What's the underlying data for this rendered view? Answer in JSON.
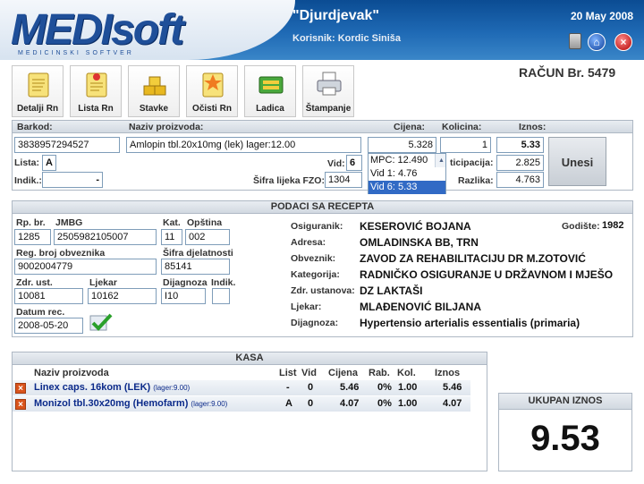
{
  "header": {
    "logo": "MEDIsoft",
    "logo_subtitle": "MEDICINSKI SOFTVER",
    "pharmacy": "\"Djurdjevak\"",
    "user": "Korisnik: Kordic Siniša",
    "date": "20 May 2008"
  },
  "toolbar": [
    {
      "label": "Detalji Rn",
      "icon": "notepad-icon"
    },
    {
      "label": "Lista Rn",
      "icon": "notepad-pin-icon"
    },
    {
      "label": "Stavke",
      "icon": "coins-icon"
    },
    {
      "label": "Očisti Rn",
      "icon": "notepad-star-icon"
    },
    {
      "label": "Ladica",
      "icon": "cash-drawer-icon"
    },
    {
      "label": "Štampanje",
      "icon": "printer-icon"
    }
  ],
  "racun": "RAČUN Br. 5479",
  "entry": {
    "labels": {
      "barkod": "Barkod:",
      "naziv": "Naziv proizvoda:",
      "cijena": "Cijena:",
      "kolicina": "Kolicina:",
      "iznos": "Iznos:",
      "lista": "Lista:",
      "indik": "Indik.:",
      "vid": "Vid:",
      "sifra": "Šifra lijeka FZO:",
      "participacija": "ticipacija:",
      "razlika": "Razlika:"
    },
    "barkod": "3838957294527",
    "naziv": "Amlopin tbl.20x10mg (lek) lager:12.00",
    "cijena": "5.328",
    "kolicina": "1",
    "iznos": "5.33",
    "lista": "A",
    "indik": "-",
    "vid": "6",
    "sifra": "1304",
    "participacija": "2.825",
    "razlika": "4.763",
    "unesi": "Unesi",
    "dropdown": [
      "MPC: 12.490",
      "Vid 1: 4.76",
      "Vid 6: 5.33"
    ]
  },
  "recept": {
    "title": "PODACI SA RECEPTA",
    "labels": {
      "rp": "Rp. br.",
      "jmbg": "JMBG",
      "kat": "Kat.",
      "opstina": "Opština",
      "reg": "Reg. broj obveznika",
      "sifra_dj": "Šifra djelatnosti",
      "zdr": "Zdr. ust.",
      "ljekar": "Ljekar",
      "dijagnoza": "Dijagnoza",
      "indik": "Indik.",
      "datum": "Datum rec."
    },
    "rp": "1285",
    "jmbg": "2505982105007",
    "kat": "11",
    "opstina": "002",
    "reg": "9002004779",
    "sifra_dj": "85141",
    "zdr": "10081",
    "ljekar": "10162",
    "dijagnoza": "I10",
    "indik": "",
    "datum": "2008-05-20",
    "info": [
      {
        "label": "Osiguranik:",
        "value": "KESEROVIĆ BOJANA"
      },
      {
        "label": "Adresa:",
        "value": "OMLADINSKA BB, TRN"
      },
      {
        "label": "Obveznik:",
        "value": "ZAVOD ZA REHABILITACIJU DR M.ZOTOVIĆ"
      },
      {
        "label": "Kategorija:",
        "value": "RADNIČKO OSIGURANJE U DRŽAVNOM I MJEŠO"
      },
      {
        "label": "Zdr. ustanova:",
        "value": "DZ LAKTAŠI"
      },
      {
        "label": "Ljekar:",
        "value": "MLAĐENOVIĆ BILJANA"
      },
      {
        "label": "Dijagnoza:",
        "value": "Hypertensio arterialis essentialis (primaria)"
      }
    ],
    "godiste_label": "Godište:",
    "godiste": "1982"
  },
  "kasa": {
    "title": "KASA",
    "columns": {
      "naziv": "Naziv proizvoda",
      "list": "List",
      "vid": "Vid",
      "cijena": "Cijena",
      "rab": "Rab.",
      "kol": "Kol.",
      "iznos": "Iznos"
    },
    "rows": [
      {
        "naziv": "Linex caps. 16kom (LEK)",
        "lager": "(lager:9.00)",
        "list": "-",
        "vid": "0",
        "cijena": "5.46",
        "rab": "0%",
        "kol": "1.00",
        "iznos": "5.46"
      },
      {
        "naziv": "Monizol tbl.30x20mg (Hemofarm)",
        "lager": "(lager:9.00)",
        "list": "A",
        "vid": "0",
        "cijena": "4.07",
        "rab": "0%",
        "kol": "1.00",
        "iznos": "4.07"
      }
    ]
  },
  "total": {
    "label": "UKUPAN IZNOS",
    "value": "9.53"
  },
  "colors": {
    "header_blue": "#1f6ab5",
    "selection_blue": "#316ac5",
    "delete_orange": "#d9541c"
  }
}
